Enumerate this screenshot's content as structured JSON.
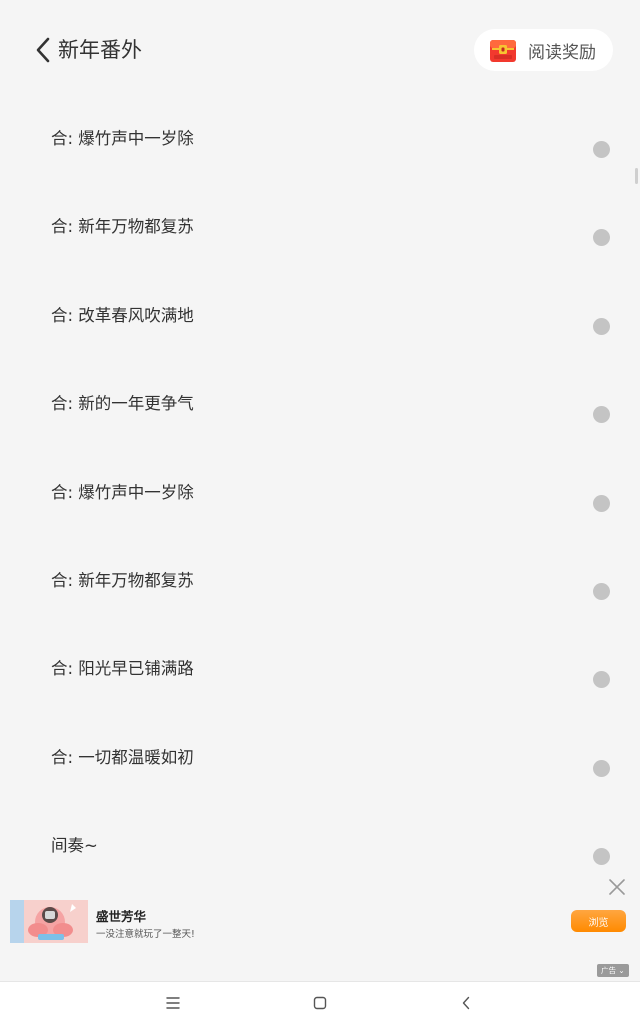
{
  "header": {
    "title": "新年番外",
    "reward_label": "阅读奖励"
  },
  "lyrics": [
    "合: 爆竹声中一岁除",
    "合: 新年万物都复苏",
    "合: 改革春风吹满地",
    "合: 新的一年更争气",
    "合: 爆竹声中一岁除",
    "合: 新年万物都复苏",
    "合: 阳光早已铺满路",
    "合: 一切都温暖如初",
    "间奏~"
  ],
  "ad": {
    "title": "盛世芳华",
    "description": "一没注意就玩了一整天!",
    "cta_label": "浏览",
    "tag_label": "广告"
  },
  "colors": {
    "background": "#f5f5f5",
    "dot": "#c4c4c4",
    "cta": "#ff9a1f"
  },
  "icons": {
    "back": "chevron-left-icon",
    "reward": "treasure-chest-icon",
    "close": "close-icon",
    "nav_menu": "menu-icon",
    "nav_home": "square-home-icon",
    "nav_back": "chevron-left-icon"
  }
}
